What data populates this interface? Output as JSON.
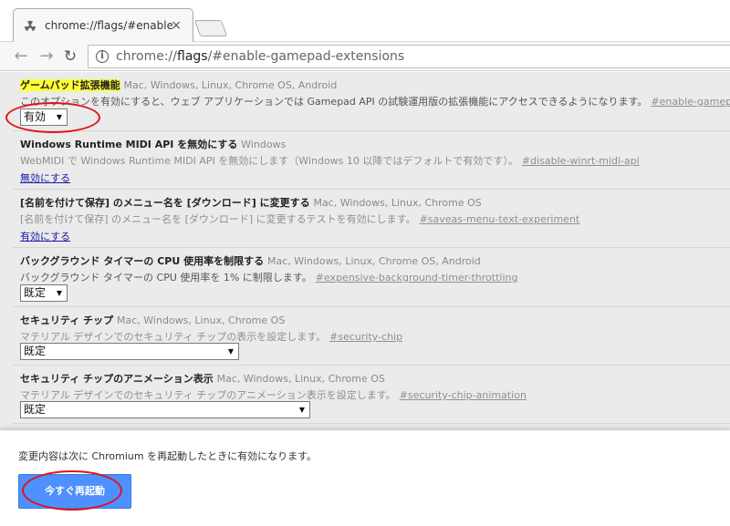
{
  "tab": {
    "title": "chrome://flags/#enable-",
    "close": "×",
    "icon": "radiation-icon"
  },
  "toolbar": {
    "back": "←",
    "forward": "→",
    "reload": "↻",
    "url_prefix": "chrome://",
    "url_host": "flags",
    "url_rest": "/#enable-gamepad-extensions",
    "info": "i"
  },
  "experiments": [
    {
      "title": "ゲームパッド拡張機能",
      "platforms": "Mac, Windows, Linux, Chrome OS, Android",
      "description": "このオプションを有効にすると、ウェブ アプリケーションでは Gamepad API の試験運用版の拡張機能にアクセスできるようになります。",
      "permalink": "#enable-gamepad-extensions",
      "control": "有効",
      "arrow": "▼"
    },
    {
      "title": "Windows Runtime MIDI API を無効にする",
      "platforms": "Windows",
      "description": "WebMIDI で Windows Runtime MIDI API を無効にします（Windows 10 以降ではデフォルトで有効です）。",
      "permalink": "#disable-winrt-midi-api",
      "link": "無効にする"
    },
    {
      "title": "[名前を付けて保存] のメニュー名を [ダウンロード] に変更する",
      "platforms": "Mac, Windows, Linux, Chrome OS",
      "description": "[名前を付けて保存] のメニュー名を [ダウンロード] に変更するテストを有効にします。",
      "permalink": "#saveas-menu-text-experiment",
      "link": "有効にする"
    },
    {
      "title": "バックグラウンド タイマーの CPU 使用率を制限する",
      "platforms": "Mac, Windows, Linux, Chrome OS, Android",
      "description": "バックグラウンド タイマーの CPU 使用率を 1% に制限します。",
      "permalink": "#expensive-background-timer-throttling",
      "control": "既定",
      "arrow": "▼"
    },
    {
      "title": "セキュリティ チップ",
      "platforms": "Mac, Windows, Linux, Chrome OS",
      "description": "マテリアル デザインでのセキュリティ チップの表示を設定します。",
      "permalink": "#security-chip",
      "control": "既定",
      "arrow": "▼"
    },
    {
      "title": "セキュリティ チップのアニメーション表示",
      "platforms": "Mac, Windows, Linux, Chrome OS",
      "description": "マテリアル デザインでのセキュリティ チップのアニメーション表示を設定します。",
      "permalink": "#security-chip-animation",
      "control": "既定",
      "arrow": "▼"
    }
  ],
  "bottom": {
    "message": "変更内容は次に Chromium を再起動したときに有効になります。",
    "restart_label": "今すぐ再起動"
  },
  "colors": {
    "highlight": "#ffff33",
    "annotation": "#e0131a",
    "button": "#4d90fe",
    "link": "#1a1aa6"
  }
}
